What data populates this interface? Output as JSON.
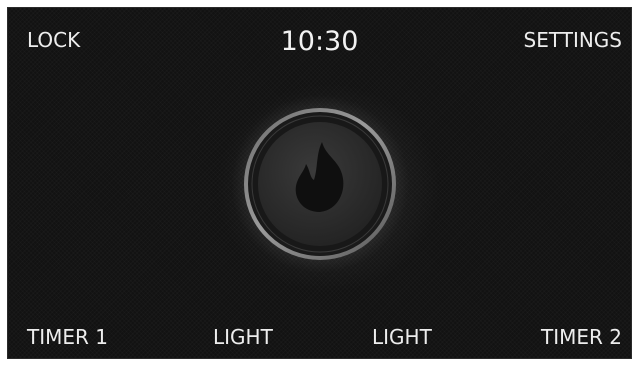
{
  "header": {
    "lock_label": "LOCK",
    "time": "10:30",
    "settings_label": "SETTINGS"
  },
  "main": {
    "center_button": {
      "icon": "flame-icon"
    }
  },
  "footer": {
    "timer1_label": "TIMER 1",
    "light1_label": "LIGHT",
    "light2_label": "LIGHT",
    "timer2_label": "TIMER 2"
  },
  "colors": {
    "background": "#121212",
    "text": "#ededed",
    "ring": "#8a8a8a",
    "button_face": "#2e2e2e",
    "flame": "#0f0f0f"
  }
}
